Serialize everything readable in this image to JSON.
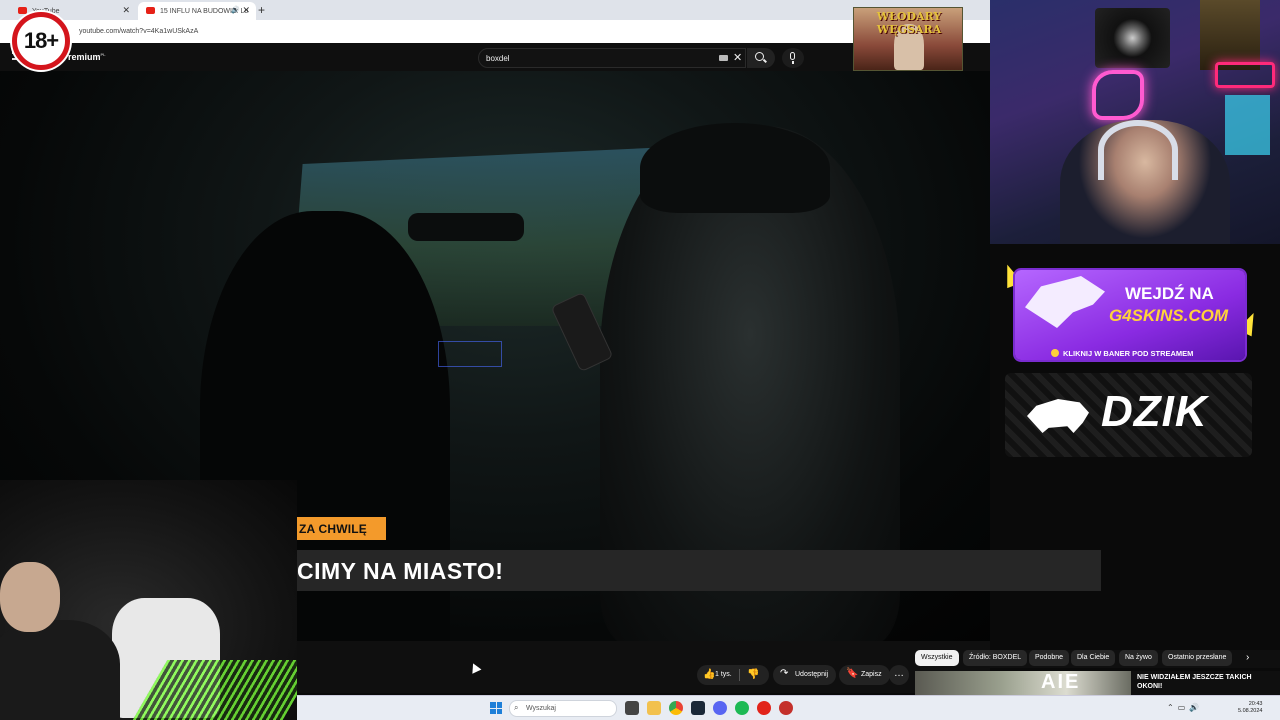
{
  "browser": {
    "tabs": [
      {
        "label": "YouTube",
        "active": false
      },
      {
        "label": "15 INFLU NA BUDOWIE: Lo",
        "active": true
      }
    ],
    "new_tab": "+",
    "close_glyph": "✕",
    "url": "youtube.com/watch?v=4Ka1wUSkAzA"
  },
  "youtube": {
    "brand": "Premium",
    "brand_region": "PL",
    "search_value": "boxdel",
    "overlay_tag": "ZA CHWILĘ",
    "video_title_overlay": "CIMY NA MIASTO!",
    "actions": {
      "like_count": "1 tys.",
      "share": "Udostępnij",
      "save": "Zapisz",
      "more": "…"
    },
    "chips": [
      "Wszystkie",
      "Źródło: BOXDEL",
      "Podobne",
      "Dla Ciebie",
      "Na żywo",
      "Ostatnio przesłane"
    ],
    "chips_next": "›",
    "recommended": {
      "thumb_text": "AIE",
      "title": "NIE WIDZIAŁEM JESZCZE TAKICH OKONI!"
    }
  },
  "overlay": {
    "age_badge": "18+",
    "poster_title": "WŁODARY WĘGSARA",
    "g4skins": {
      "line1": "WEJDŹ NA",
      "line2": "G4SKINS.COM",
      "footer": "KLIKNIJ W BANER POD STREAMEM"
    },
    "dzik": {
      "brand": "DZIK"
    }
  },
  "taskbar": {
    "search_placeholder": "Wyszukaj",
    "time": "20:43",
    "date": "5.08.2024"
  },
  "colors": {
    "yt_bg": "#0f0f0f",
    "overlay_orange": "#f39a2b",
    "age_red": "#d4151c",
    "g4_purple": "#8a2be2",
    "g4_yellow": "#ffd23a"
  },
  "icons": [
    "youtube-favicon",
    "speaker-icon",
    "close-icon",
    "menu-icon",
    "keyboard-icon",
    "search-icon",
    "mic-icon",
    "like-icon",
    "dislike-icon",
    "share-icon",
    "save-icon",
    "more-icon",
    "windows-icon",
    "chevron-right-icon"
  ]
}
